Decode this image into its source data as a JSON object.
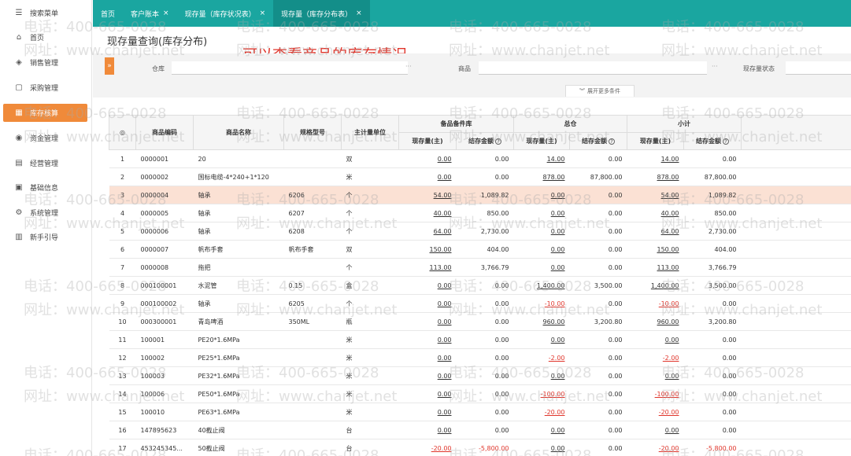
{
  "sidebar": {
    "items": [
      {
        "label": "搜索菜单",
        "icon": "search-menu-icon",
        "glyph": "☰"
      },
      {
        "label": "首页",
        "icon": "home-icon",
        "glyph": "⌂"
      },
      {
        "label": "销售管理",
        "icon": "sales-icon",
        "glyph": "◈"
      },
      {
        "label": "采购管理",
        "icon": "purchase-icon",
        "glyph": "▢"
      },
      {
        "label": "库存核算",
        "icon": "inventory-icon",
        "glyph": "▦",
        "active": true
      },
      {
        "label": "资金管理",
        "icon": "funds-icon",
        "glyph": "◉"
      },
      {
        "label": "经营管理",
        "icon": "operations-icon",
        "glyph": "▤"
      },
      {
        "label": "基础信息",
        "icon": "basic-info-icon",
        "glyph": "▣"
      },
      {
        "label": "系统管理",
        "icon": "system-icon",
        "glyph": "⚙"
      },
      {
        "label": "新手引导",
        "icon": "guide-icon",
        "glyph": "▥"
      }
    ]
  },
  "tabs": [
    {
      "label": "首页",
      "closable": false,
      "active": false
    },
    {
      "label": "客户账本",
      "closable": true,
      "active": false
    },
    {
      "label": "现存量（库存状况表）",
      "closable": true,
      "active": false
    },
    {
      "label": "现存量（库存分布表）",
      "closable": true,
      "active": true
    }
  ],
  "page": {
    "title": "现存量查询(库存分布)",
    "annotation": "可以查看商品的库存情况"
  },
  "filters": {
    "expand_glyph": "»",
    "warehouse_label": "仓库",
    "product_label": "商品",
    "status_label": "现存量状态",
    "dots": "···",
    "more_conditions": "展开更多条件"
  },
  "table": {
    "headers": {
      "index": "◎",
      "code": "商品编码",
      "name": "商品名称",
      "spec": "规格型号",
      "unit": "主计量单位",
      "group1": "备品备件库",
      "group2": "总仓",
      "group3": "小计",
      "qty": "现存量(主)",
      "amount": "结存金额",
      "help": "?"
    },
    "rows": [
      {
        "no": "1",
        "code": "0000001",
        "name": "20",
        "spec": "",
        "unit": "双",
        "q1": "0.00",
        "a1": "0.00",
        "q2": "14.00",
        "a2": "0.00",
        "q3": "14.00",
        "a3": "0.00"
      },
      {
        "no": "2",
        "code": "0000002",
        "name": "国标电缆-4*240+1*120",
        "spec": "",
        "unit": "米",
        "q1": "0.00",
        "a1": "0.00",
        "q2": "878.00",
        "a2": "87,800.00",
        "q3": "878.00",
        "a3": "87,800.00"
      },
      {
        "no": "3",
        "code": "0000004",
        "name": "轴承",
        "spec": "6206",
        "unit": "个",
        "q1": "54.00",
        "a1": "1,089.82",
        "q2": "0.00",
        "a2": "0.00",
        "q3": "54.00",
        "a3": "1,089.82",
        "highlight": true
      },
      {
        "no": "4",
        "code": "0000005",
        "name": "轴承",
        "spec": "6207",
        "unit": "个",
        "q1": "40.00",
        "a1": "850.00",
        "q2": "0.00",
        "a2": "0.00",
        "q3": "40.00",
        "a3": "850.00"
      },
      {
        "no": "5",
        "code": "0000006",
        "name": "轴承",
        "spec": "6208",
        "unit": "个",
        "q1": "64.00",
        "a1": "2,730.00",
        "q2": "0.00",
        "a2": "0.00",
        "q3": "64.00",
        "a3": "2,730.00"
      },
      {
        "no": "6",
        "code": "0000007",
        "name": "帆布手套",
        "spec": "帆布手套",
        "unit": "双",
        "q1": "150.00",
        "a1": "404.00",
        "q2": "0.00",
        "a2": "0.00",
        "q3": "150.00",
        "a3": "404.00"
      },
      {
        "no": "7",
        "code": "0000008",
        "name": "拖把",
        "spec": "",
        "unit": "个",
        "q1": "113.00",
        "a1": "3,766.79",
        "q2": "0.00",
        "a2": "0.00",
        "q3": "113.00",
        "a3": "3,766.79"
      },
      {
        "no": "8",
        "code": "000100001",
        "name": "水泥管",
        "spec": "0.15",
        "unit": "盒",
        "q1": "0.00",
        "a1": "0.00",
        "q2": "1,400.00",
        "a2": "3,500.00",
        "q3": "1,400.00",
        "a3": "3,500.00"
      },
      {
        "no": "9",
        "code": "000100002",
        "name": "轴承",
        "spec": "6205",
        "unit": "个",
        "q1": "0.00",
        "a1": "0.00",
        "q2": "-10.00",
        "a2": "0.00",
        "q3": "-10.00",
        "a3": "0.00"
      },
      {
        "no": "10",
        "code": "000300001",
        "name": "青岛啤酒",
        "spec": "350ML",
        "unit": "瓶",
        "q1": "0.00",
        "a1": "0.00",
        "q2": "960.00",
        "a2": "3,200.80",
        "q3": "960.00",
        "a3": "3,200.80"
      },
      {
        "no": "11",
        "code": "100001",
        "name": "PE20*1.6MPa",
        "spec": "",
        "unit": "米",
        "q1": "0.00",
        "a1": "0.00",
        "q2": "0.00",
        "a2": "0.00",
        "q3": "0.00",
        "a3": "0.00"
      },
      {
        "no": "12",
        "code": "100002",
        "name": "PE25*1.6MPa",
        "spec": "",
        "unit": "米",
        "q1": "0.00",
        "a1": "0.00",
        "q2": "-2.00",
        "a2": "0.00",
        "q3": "-2.00",
        "a3": "0.00"
      },
      {
        "no": "13",
        "code": "100003",
        "name": "PE32*1.6MPa",
        "spec": "",
        "unit": "米",
        "q1": "0.00",
        "a1": "0.00",
        "q2": "0.00",
        "a2": "0.00",
        "q3": "0.00",
        "a3": "0.00"
      },
      {
        "no": "14",
        "code": "100006",
        "name": "PE50*1.6MPa",
        "spec": "",
        "unit": "米",
        "q1": "0.00",
        "a1": "0.00",
        "q2": "-100.00",
        "a2": "0.00",
        "q3": "-100.00",
        "a3": "0.00"
      },
      {
        "no": "15",
        "code": "100010",
        "name": "PE63*1.6MPa",
        "spec": "",
        "unit": "米",
        "q1": "0.00",
        "a1": "0.00",
        "q2": "-20.00",
        "a2": "0.00",
        "q3": "-20.00",
        "a3": "0.00"
      },
      {
        "no": "16",
        "code": "147895623",
        "name": "40截止阀",
        "spec": "",
        "unit": "台",
        "q1": "0.00",
        "a1": "0.00",
        "q2": "0.00",
        "a2": "0.00",
        "q3": "0.00",
        "a3": "0.00"
      },
      {
        "no": "17",
        "code": "453245345...",
        "name": "50截止阀",
        "spec": "",
        "unit": "台",
        "q1": "-20.00",
        "a1": "-5,800.00",
        "q2": "0.00",
        "a2": "0.00",
        "q3": "-20.00",
        "a3": "-5,800.00"
      }
    ]
  },
  "watermark": {
    "phone": "电话：400-665-0028",
    "site": "网址：www.chanjet.net"
  },
  "colors": {
    "tabbar": "#1aa6a0",
    "active_tab": "#138e89",
    "accent": "#f08a3a",
    "highlight_row": "#fbe1d4",
    "negative": "#e0352b",
    "annotation": "#e0352b"
  }
}
